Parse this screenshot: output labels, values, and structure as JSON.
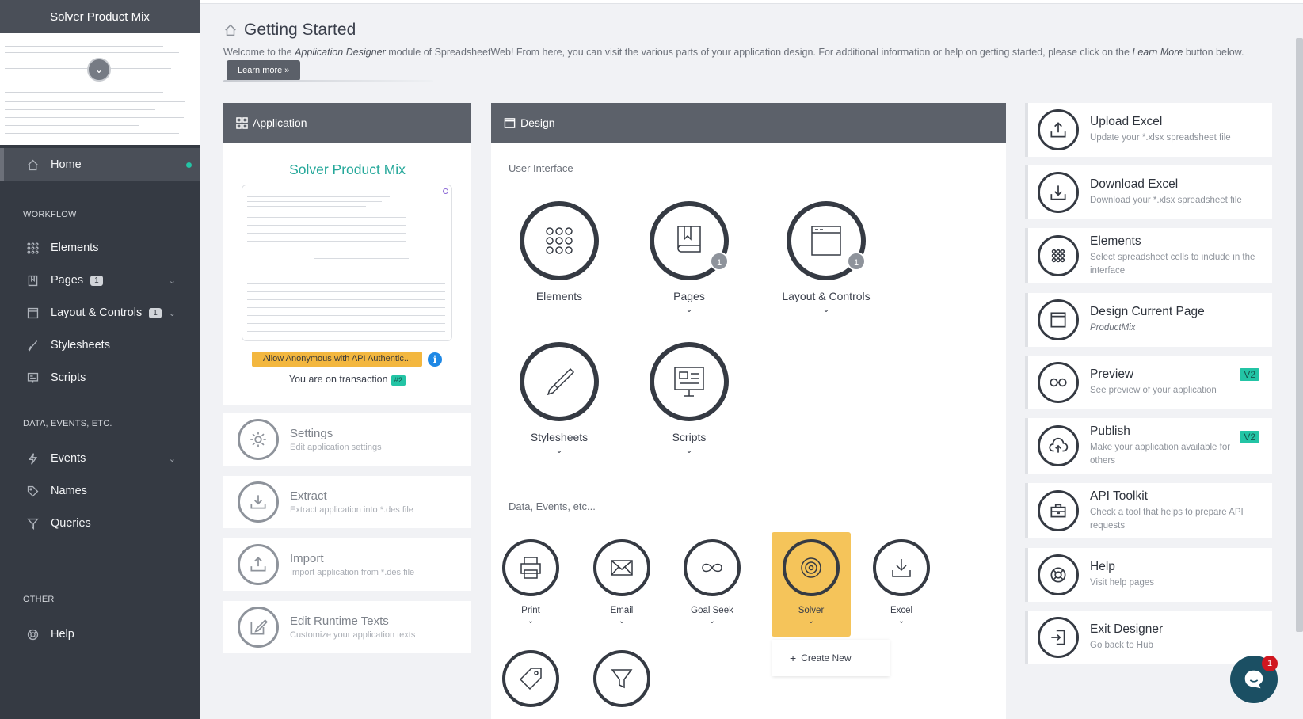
{
  "sidebar": {
    "title": "Solver Product Mix",
    "home": "Home",
    "sections": {
      "workflow": "WORKFLOW",
      "data": "DATA, EVENTS, ETC.",
      "other": "OTHER"
    },
    "items": {
      "elements": "Elements",
      "pages": "Pages",
      "pages_badge": "1",
      "layout": "Layout & Controls",
      "layout_badge": "1",
      "stylesheets": "Stylesheets",
      "scripts": "Scripts",
      "events": "Events",
      "names": "Names",
      "queries": "Queries",
      "help": "Help"
    }
  },
  "header": {
    "title": "Getting Started",
    "intro_a": "Welcome to the ",
    "intro_em1": "Application Designer",
    "intro_b": " module of SpreadsheetWeb! From here, you can visit the various parts of your application design. For additional information or help on getting started, please click on the ",
    "intro_em2": "Learn More",
    "intro_c": " button below.",
    "learn_btn": "Learn more »"
  },
  "application": {
    "heading": "Application",
    "name": "Solver Product Mix",
    "auth": "Allow Anonymous with API Authentic...",
    "info": "i",
    "transaction_label": "You are on transaction",
    "transaction_badge": "#2",
    "cards": [
      {
        "title": "Settings",
        "sub": "Edit application settings"
      },
      {
        "title": "Extract",
        "sub": "Extract application into *.des file"
      },
      {
        "title": "Import",
        "sub": "Import application from *.des file"
      },
      {
        "title": "Edit Runtime Texts",
        "sub": "Customize your application texts"
      }
    ]
  },
  "design": {
    "heading": "Design",
    "ui_section": "User Interface",
    "data_section": "Data, Events, etc...",
    "ui_items": [
      {
        "label": "Elements"
      },
      {
        "label": "Pages",
        "badge": "1"
      },
      {
        "label": "Layout & Controls",
        "badge": "1"
      },
      {
        "label": "Stylesheets"
      },
      {
        "label": "Scripts"
      }
    ],
    "data_items": [
      {
        "label": "Print"
      },
      {
        "label": "Email"
      },
      {
        "label": "Goal Seek"
      },
      {
        "label": "Solver"
      },
      {
        "label": "Excel"
      }
    ],
    "create_new": "Create New",
    "highlight_color": "#f5c45a"
  },
  "right": [
    {
      "title": "Upload Excel",
      "sub": "Update your *.xlsx spreadsheet file"
    },
    {
      "title": "Download Excel",
      "sub": "Download your *.xlsx spreadsheet file"
    },
    {
      "title": "Elements",
      "sub": "Select spreadsheet cells to include in the interface"
    },
    {
      "title": "Design Current Page",
      "sub": "ProductMix"
    },
    {
      "title": "Preview",
      "sub": "See preview of your application",
      "tag": "V2"
    },
    {
      "title": "Publish",
      "sub": "Make your application available for others",
      "tag": "V2"
    },
    {
      "title": "API Toolkit",
      "sub": "Check a tool that helps to prepare API requests"
    },
    {
      "title": "Help",
      "sub": "Visit help pages"
    },
    {
      "title": "Exit Designer",
      "sub": "Go back to Hub"
    }
  ],
  "chat": {
    "badge": "1"
  },
  "colors": {
    "accent": "#23c4a5",
    "sidebar": "#353a43",
    "auth": "#f3b73f",
    "info": "#1e88e5"
  }
}
